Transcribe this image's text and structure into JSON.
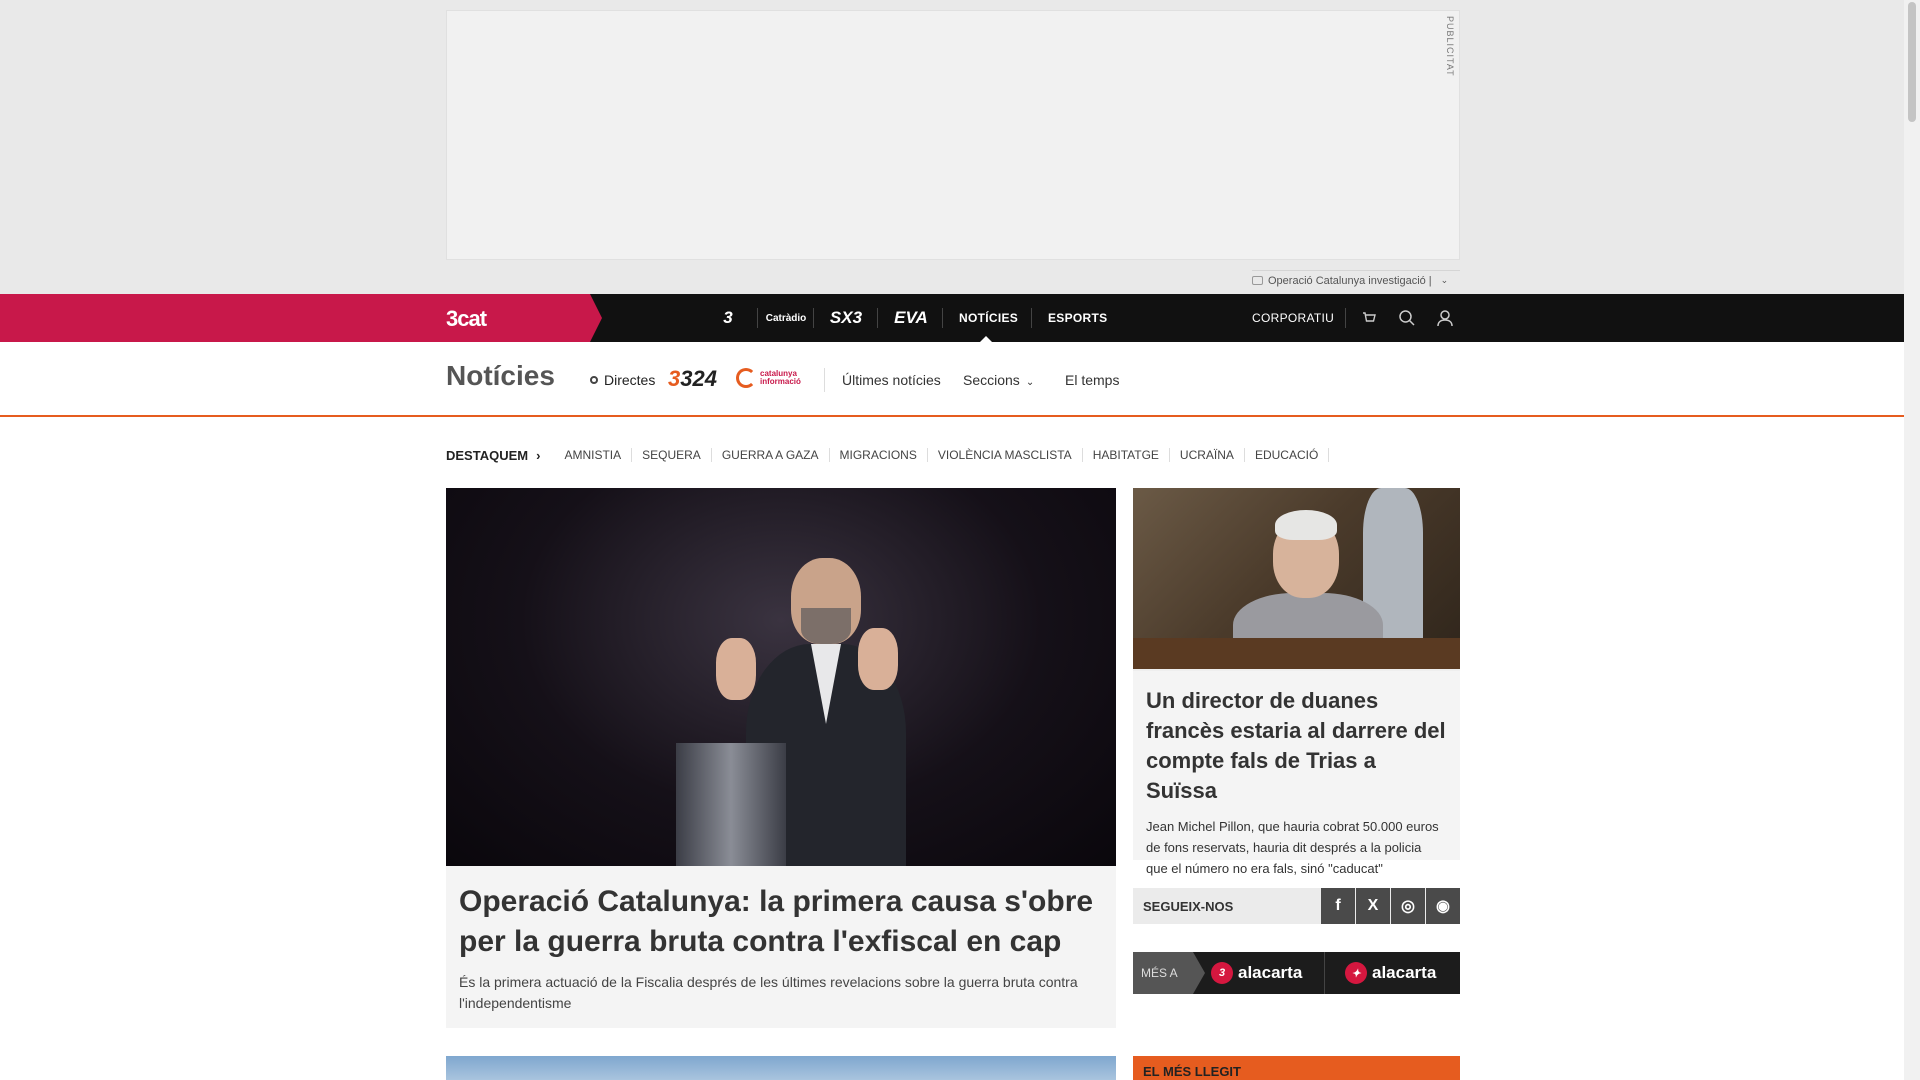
{
  "ad": {
    "label": "PUBLICITAT",
    "topic_tag": "Operació Catalunya investigació |"
  },
  "topnav": {
    "brand": "3cat",
    "channels": [
      "3",
      "Catràdio",
      "SX3",
      "EVA"
    ],
    "links": [
      "NOTÍCIES",
      "ESPORTS"
    ],
    "active": "NOTÍCIES",
    "corporate": "CORPORATIU",
    "icons": [
      "cart-icon",
      "search-icon",
      "user-icon"
    ]
  },
  "section": {
    "title": "Notícies",
    "directes": "Directes",
    "logo_324": "324",
    "logo_catinfo_line1": "catalunya",
    "logo_catinfo_line2": "informació",
    "links": [
      "Últimes notícies",
      "Seccions",
      "El temps"
    ]
  },
  "highlights": {
    "title": "DESTAQUEM",
    "items": [
      "AMNISTIA",
      "SEQUERA",
      "GUERRA A GAZA",
      "MIGRACIONS",
      "VIOLÈNCIA MASCLISTA",
      "HABITATGE",
      "UCRAÏNA",
      "EDUCACIÓ"
    ]
  },
  "main_story": {
    "headline": "Operació Catalunya: la primera causa s'obre per la guerra bruta contra l'exfiscal en cap",
    "lead": "És la primera actuació de la Fiscalia després de les últimes revelacions sobre la guerra bruta contra l'independentisme"
  },
  "side_story": {
    "headline": "Un director de duanes francès estaria al darrere del compte fals de Trias a Suïssa",
    "lead": "Jean Michel Pillon, que hauria cobrat 50.000 euros de fons reservats, hauria dit després a la policia que el número no era fals, sinó \"caducat\""
  },
  "follow": {
    "label": "SEGUEIX-NOS",
    "networks": [
      "f",
      "X",
      "◎",
      "◉"
    ]
  },
  "alacarta": {
    "prefix": "MÉS A",
    "brand1": "alacarta",
    "brand2": "alacarta",
    "badge1": "3"
  },
  "most_read": {
    "label": "EL MÉS LLEGIT"
  }
}
